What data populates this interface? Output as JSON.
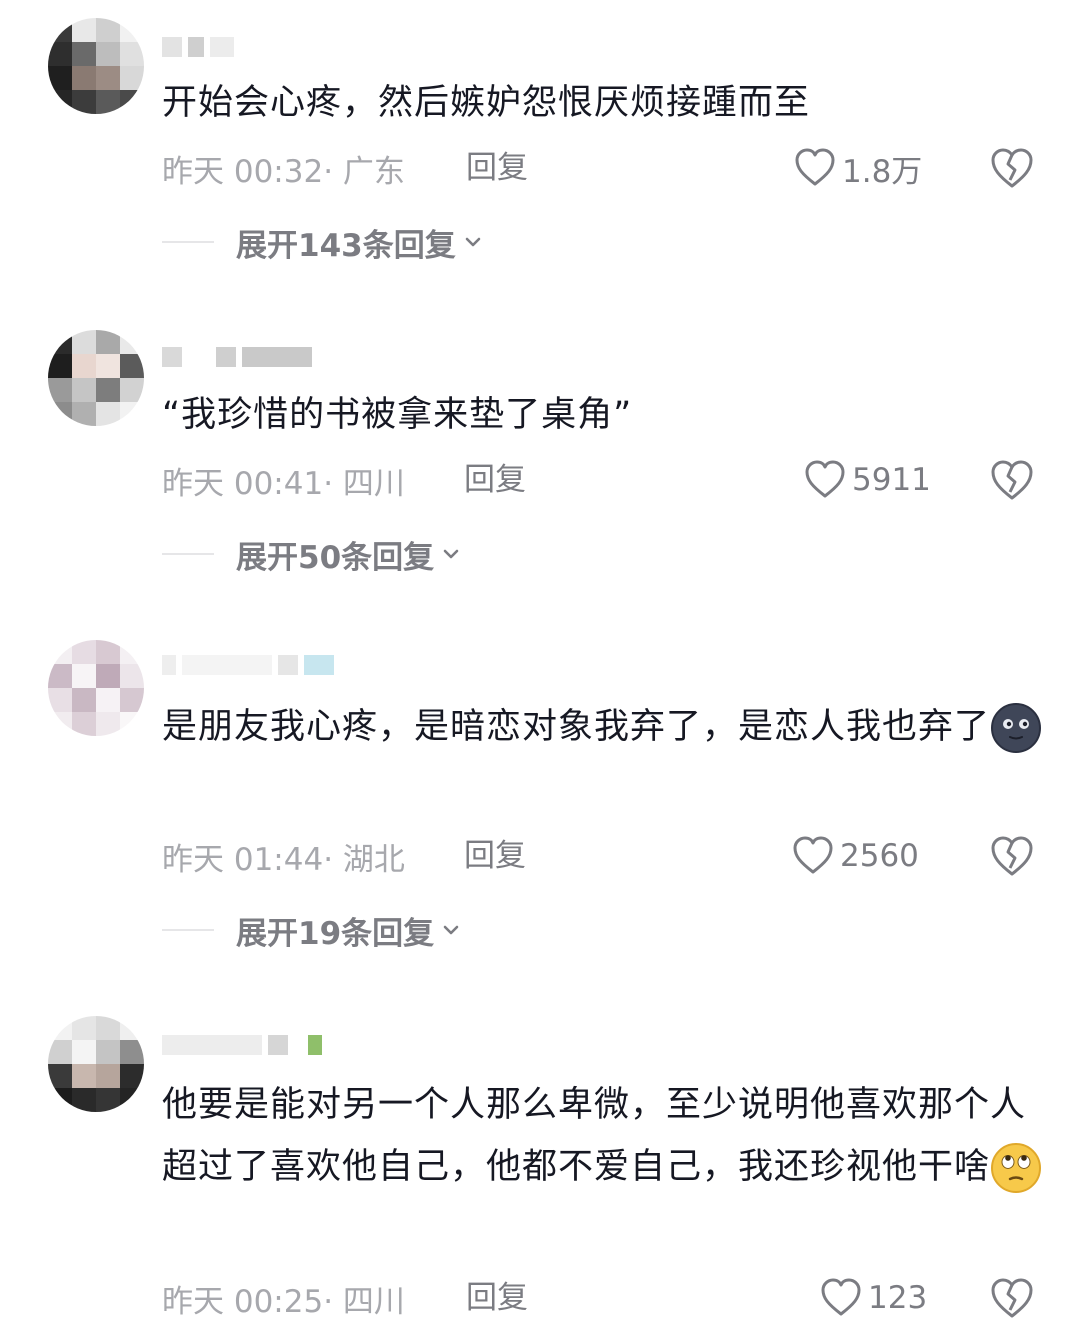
{
  "comments": [
    {
      "text": "开始会心疼，然后嫉妒怨恨厌烦接踵而至",
      "time": "昨天 00:32",
      "location": "· 广东",
      "reply_label": "回复",
      "likes": "1.8万",
      "expand_label": "展开143条回复"
    },
    {
      "text": "“我珍惜的书被拿来垫了桌角”",
      "time": "昨天 00:41",
      "location": "· 四川",
      "reply_label": "回复",
      "likes": "5911",
      "expand_label": "展开50条回复"
    },
    {
      "text": "是朋友我心疼，是暗恋对象我弃了，是恋人我也弃了",
      "emoji": "moon-face-emoji",
      "time": "昨天 01:44",
      "location": "· 湖北",
      "reply_label": "回复",
      "likes": "2560",
      "expand_label": "展开19条回复"
    },
    {
      "text": "他要是能对另一个人那么卑微，至少说明他喜欢那个人超过了喜欢他自己，他都不爱自己，我还珍视他干啥",
      "emoji": "eye-roll-emoji",
      "time": "昨天 00:25",
      "location": "· 四川",
      "reply_label": "回复",
      "likes": "123"
    }
  ],
  "colors": {
    "primary_text": "#161823",
    "secondary_text": "#a7a8ad",
    "action_text": "#7b7c82"
  },
  "icons": [
    "heart-outline-icon",
    "broken-heart-icon",
    "chevron-down-icon"
  ]
}
